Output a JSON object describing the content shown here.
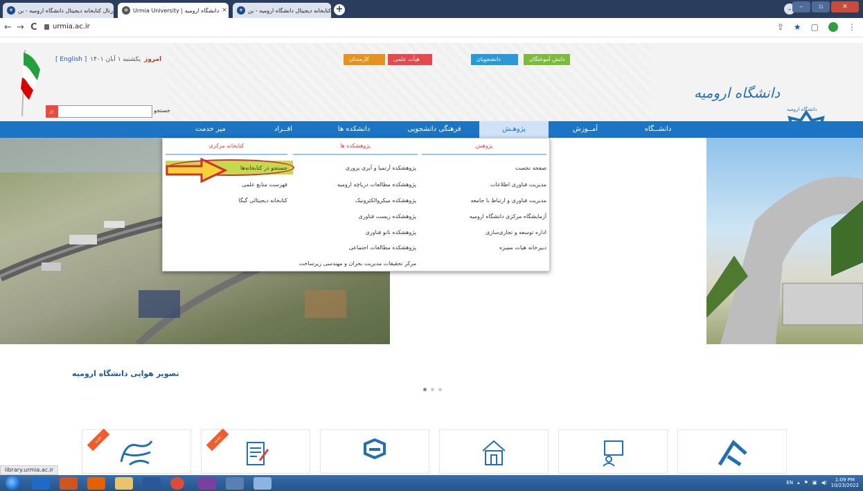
{
  "browser": {
    "tabs": [
      {
        "label": "پورتال کتابخانه دیجیتال دانشگاه ارومیه - بن...",
        "icon": "uu-favicon",
        "close": "×"
      },
      {
        "label": "Urmia University | دانشگاه ارومیه",
        "icon": "settings-favicon",
        "close": "×"
      },
      {
        "label": "پورتال کتابخانه دیجیتال دانشگاه ارومیه - بن...",
        "icon": "uu-favicon",
        "close": "×"
      }
    ],
    "new_tab": "+",
    "url": "urmia.ac.ir",
    "back": "←",
    "forward": "→",
    "reload": "C",
    "profile_initial": "f"
  },
  "header": {
    "today_label": "امروز",
    "today_date": "یکشنبه ۱ آبان ۱۴۰۱",
    "english_link": "[ English ]",
    "search_label": "جستجو",
    "top_links": [
      {
        "label": "دانش آموختگان",
        "color": "#7cba3a"
      },
      {
        "label": "دانشجویان",
        "color": "#2a9ad6"
      },
      {
        "label": "هیأت علمی",
        "color": "#e5484d"
      },
      {
        "label": "کارمندان",
        "color": "#e3931e"
      }
    ],
    "logo_text": "دانشگاه ارومیه",
    "logo_sub": "دانشگاه ارومیه"
  },
  "nav": {
    "items": [
      "دانشــگاه",
      "آمــوزش",
      "پژوهـش",
      "فرهنگی دانشجویی",
      "دانشکده ها",
      "افــراد",
      "میز خدمت"
    ]
  },
  "dropdown": {
    "col1": {
      "title": "پژوهش",
      "items": [
        "صفحه نخست",
        "مدیریت فناوری اطلاعات",
        "مدیریت فناوری و ارتباط با جامعه",
        "آزمایشگاه مرکزی دانشگاه ارومیه",
        "اداره توسعه و تجاری‌سازی",
        "دبیرخانه هیات ممیزه"
      ]
    },
    "col2": {
      "title": "پژوهشکده ها",
      "items": [
        "پژوهشکده آرتمیا و آبزی پروری",
        "پژوهشکده مطالعات دریاچه ارومیه",
        "پژوهشکده میکروالکترونیک",
        "پژوهشکده زیست فناوری",
        "پژوهشکده نانو فناوری",
        "پژوهشکده مطالعات اجتماعی",
        "مرکز تحقیقات مدیریت بحران و مهندسی زیرساخت"
      ]
    },
    "col3": {
      "title": "کتابخانه مرکزی",
      "items": [
        "جستجو در کتابخانه‌ها",
        "فهرست منابع علمی",
        "کتابخانه دیجیتالی گیگا"
      ]
    }
  },
  "slider": {
    "caption": "تصویر هوایی دانشگاه ارومیه"
  },
  "cards": {
    "badge": "جدید"
  },
  "statusbar": {
    "url": "library.urmia.ac.ir"
  },
  "taskbar": {
    "lang": "EN",
    "time": "1:09 PM",
    "date": "10/23/2022"
  }
}
